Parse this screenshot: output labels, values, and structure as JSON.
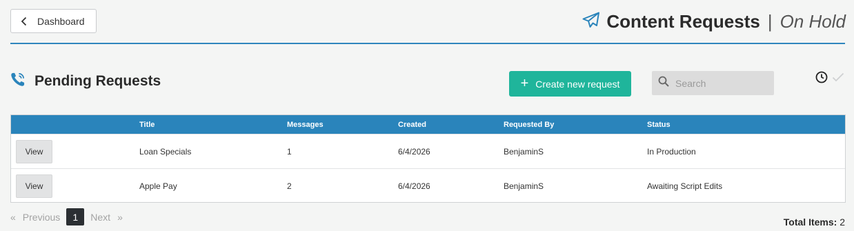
{
  "header": {
    "back_label": "Dashboard",
    "title": "Content Requests",
    "separator": "|",
    "subtitle": "On Hold"
  },
  "section": {
    "title": "Pending Requests",
    "create_label": "Create new request",
    "search_placeholder": "Search"
  },
  "table": {
    "columns": [
      "Title",
      "Messages",
      "Created",
      "Requested By",
      "Status"
    ],
    "rows": [
      {
        "action": "View",
        "title": "Loan Specials",
        "messages": "1",
        "created": "6/4/2026",
        "requested_by": "BenjaminS",
        "status": "In Production"
      },
      {
        "action": "View",
        "title": "Apple Pay",
        "messages": "2",
        "created": "6/4/2026",
        "requested_by": "BenjaminS",
        "status": "Awaiting Script Edits"
      }
    ]
  },
  "pagination": {
    "first_arrow": "«",
    "previous": "Previous",
    "current_page": "1",
    "next": "Next",
    "last_arrow": "»"
  },
  "footer": {
    "total_label": "Total Items:",
    "total_value": "2"
  },
  "colors": {
    "accent_blue": "#2a84bb",
    "create_green": "#1fb59b",
    "page_bg": "#f4f5f4"
  },
  "icons": {
    "back": "chevron-left-icon",
    "title": "paper-plane-icon",
    "section": "phone-icon",
    "search": "search-icon",
    "history": "clock-icon",
    "done": "check-icon"
  }
}
